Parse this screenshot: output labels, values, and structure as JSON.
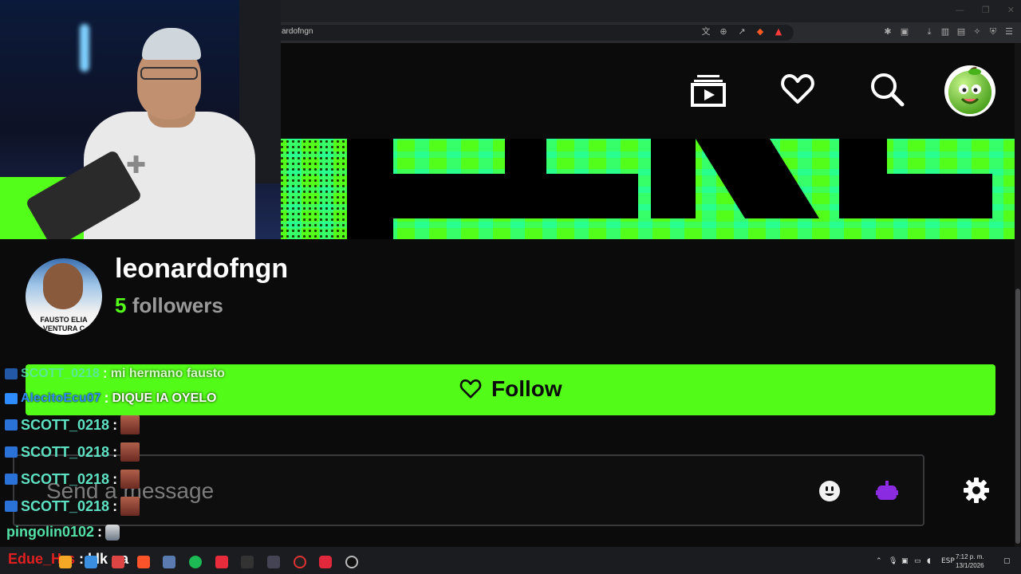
{
  "browser": {
    "url": "ardofngn",
    "window_controls": [
      "—",
      "❐",
      "✕"
    ]
  },
  "profile": {
    "username": "leonardofngn",
    "follower_count": "5",
    "followers_label": "followers",
    "avatar_text_line1": "FAUSTO ELIA",
    "avatar_text_line2": "VENTURA C"
  },
  "follow_button": {
    "label": "Follow"
  },
  "message_input": {
    "placeholder": "Send a message"
  },
  "chat": [
    {
      "user": "SCOTT_0218",
      "message": "mi hermano fausto"
    },
    {
      "user": "AlecitoEcu07",
      "message": "DIQUE IA OYELO"
    },
    {
      "user": "SCOTT_0218",
      "message": ""
    },
    {
      "user": "SCOTT_0218",
      "message": ""
    },
    {
      "user": "SCOTT_0218",
      "message": ""
    },
    {
      "user": "SCOTT_0218",
      "message": ""
    },
    {
      "user": "pingolin0102",
      "message": ""
    },
    {
      "user": "Edue_Hrs",
      "message": "klk pa"
    }
  ],
  "taskbar": {
    "language": "ESP",
    "time": "7:12 p. m.",
    "date": "13/1/2026"
  },
  "icons": {
    "header": [
      "clips-icon",
      "heart-icon",
      "search-icon",
      "avatar"
    ],
    "input": [
      "emoji-icon",
      "bot-icon",
      "settings-icon"
    ]
  }
}
